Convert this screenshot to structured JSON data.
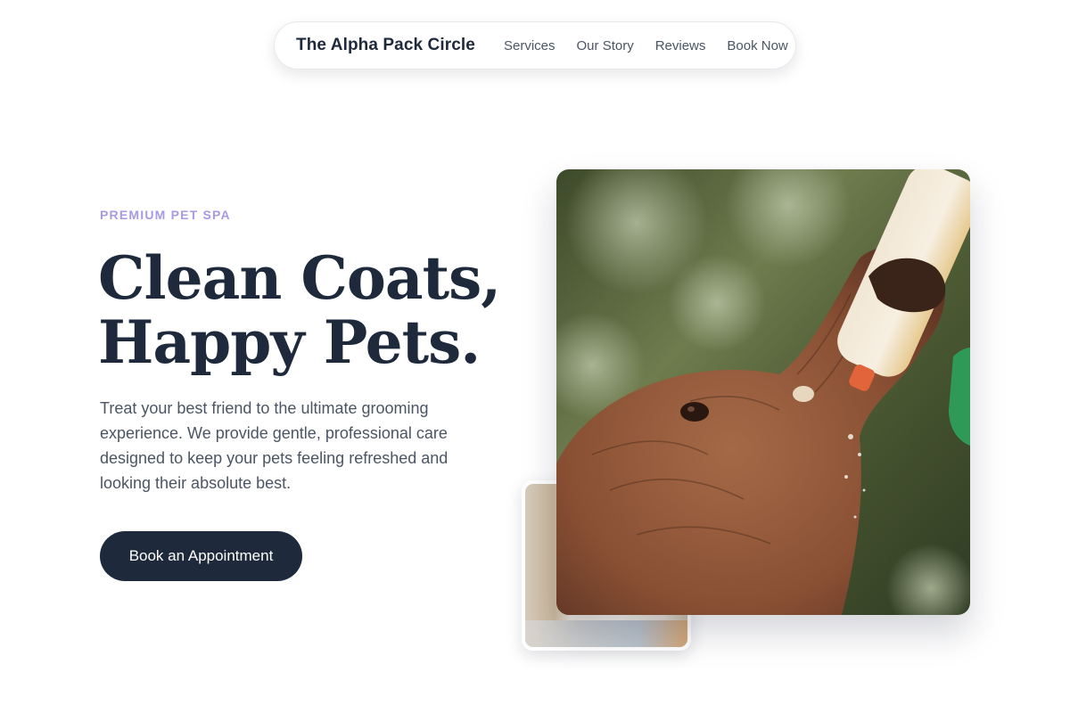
{
  "nav": {
    "brand": "The Alpha Pack Circle",
    "links": [
      "Services",
      "Our Story",
      "Reviews",
      "Book Now"
    ]
  },
  "hero": {
    "eyebrow": "PREMIUM PET SPA",
    "headline_line1": "Clean Coats,",
    "headline_line2": "Happy Pets.",
    "description": "Treat your best friend to the ultimate grooming experience. We provide gentle, professional care designed to keep your pets feeling refreshed and looking their absolute best.",
    "cta_label": "Book an Appointment"
  },
  "colors": {
    "primary": "#1e2a3b",
    "accent": "#a79ae6",
    "muted_text": "#4b5563"
  }
}
